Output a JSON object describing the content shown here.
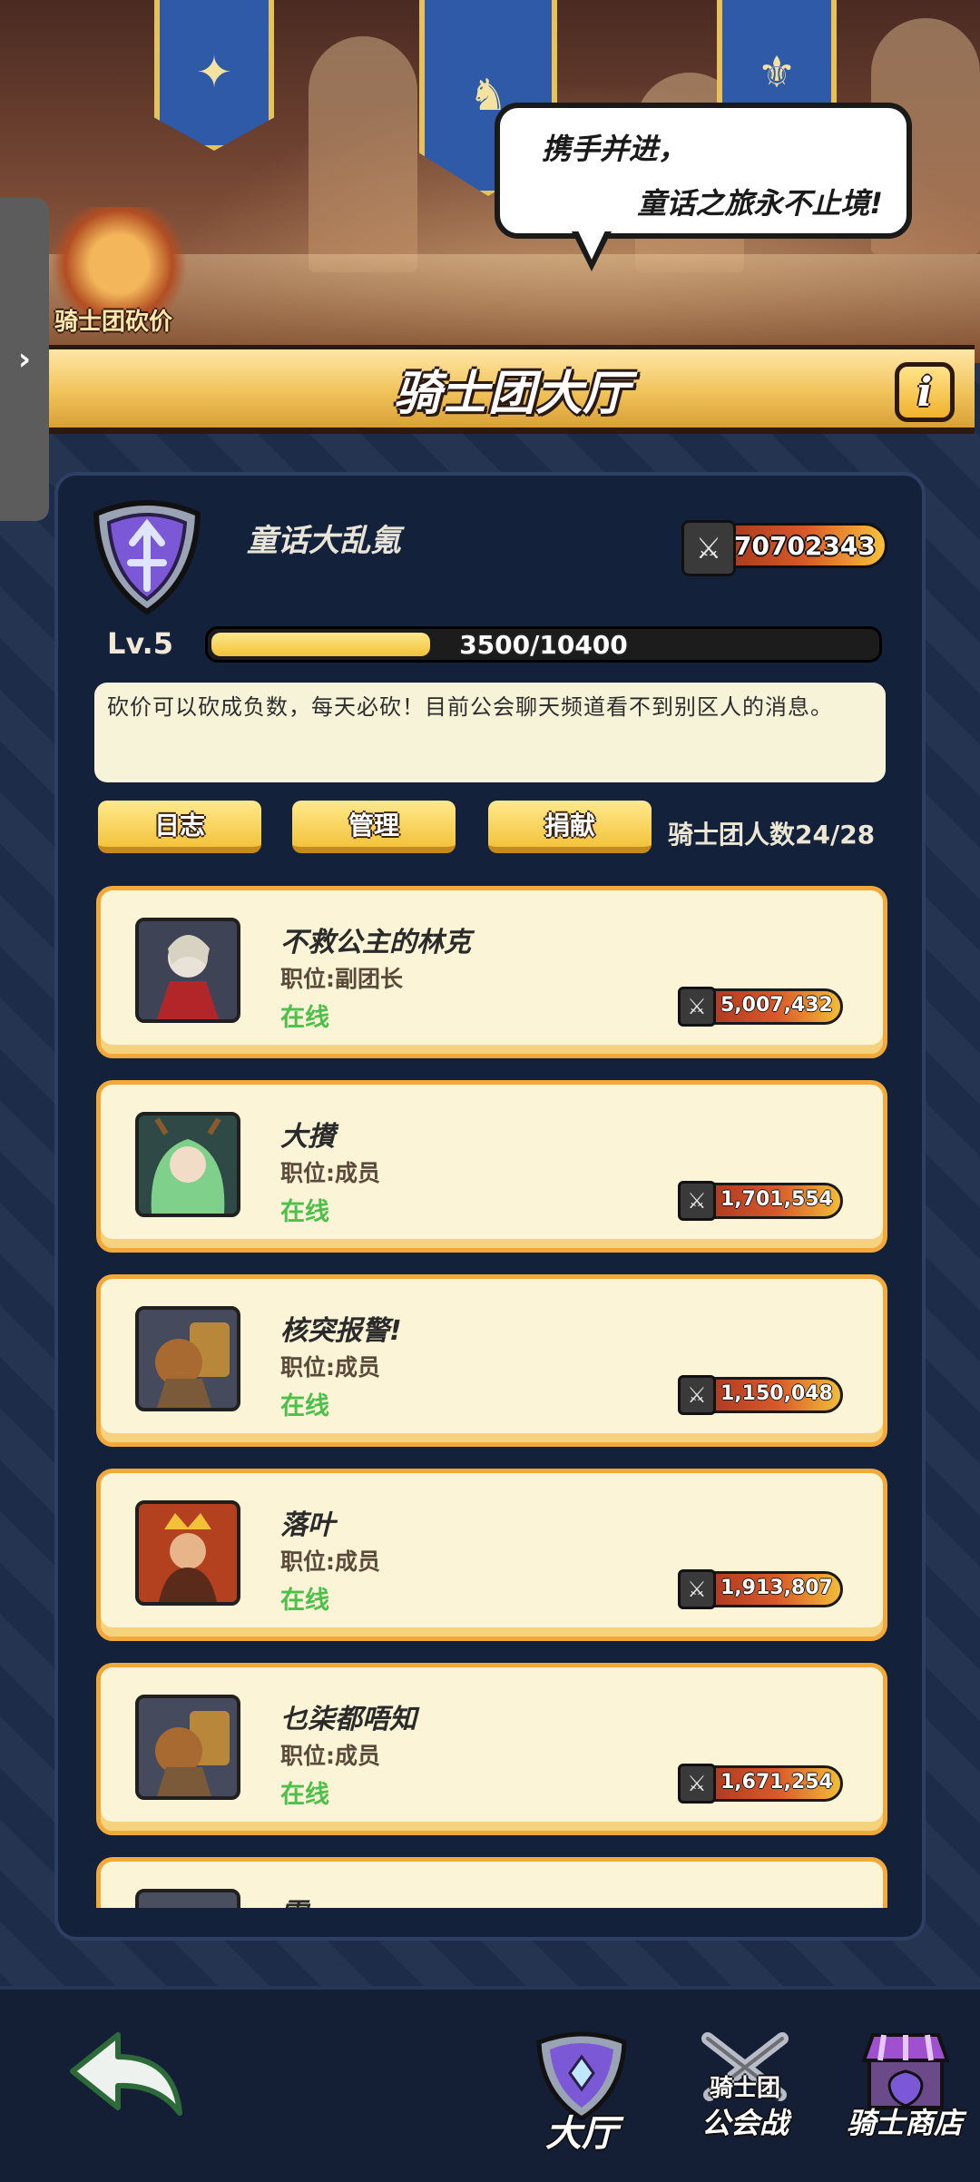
{
  "banner": {
    "speech_line1": "携手并进，",
    "speech_line2": "童话之旅永不止境!",
    "event_label": "骑士团砍价"
  },
  "side_tab": {
    "icon": "chevron-right-icon"
  },
  "header": {
    "title": "骑士团大厅",
    "info_label": "i"
  },
  "guild": {
    "name": "童话大乱氪",
    "power": "70702343",
    "level": "Lv.5",
    "xp_text": "3500/10400",
    "xp_fraction": 0.3365,
    "notice": "砍价可以砍成负数，每天必砍！目前公会聊天频道看不到别区人的消息。",
    "member_count": "骑士团人数24/28"
  },
  "actions": {
    "log_label": "日志",
    "manage_label": "管理",
    "donate_label": "捐献"
  },
  "members": [
    {
      "name": "不救公主的林克",
      "role": "职位:副团长",
      "status": "在线",
      "power": "5,007,432"
    },
    {
      "name": "大攅",
      "role": "职位:成员",
      "status": "在线",
      "power": "1,701,554"
    },
    {
      "name": "核突报警!",
      "role": "职位:成员",
      "status": "在线",
      "power": "1,150,048"
    },
    {
      "name": "落叶",
      "role": "职位:成员",
      "status": "在线",
      "power": "1,913,807"
    },
    {
      "name": "乜柒都唔知",
      "role": "职位:成员",
      "status": "在线",
      "power": "1,671,254"
    },
    {
      "name": "雪",
      "role": "",
      "status": "",
      "power": ""
    }
  ],
  "bottom_nav": {
    "hall_label": "大厅",
    "guild_war_top": "骑士团",
    "guild_war_label": "公会战",
    "shop_label": "骑士商店"
  },
  "colors": {
    "accent_gold": "#f2c13a",
    "online_green": "#4cc04a",
    "panel_navy": "#13213b"
  }
}
